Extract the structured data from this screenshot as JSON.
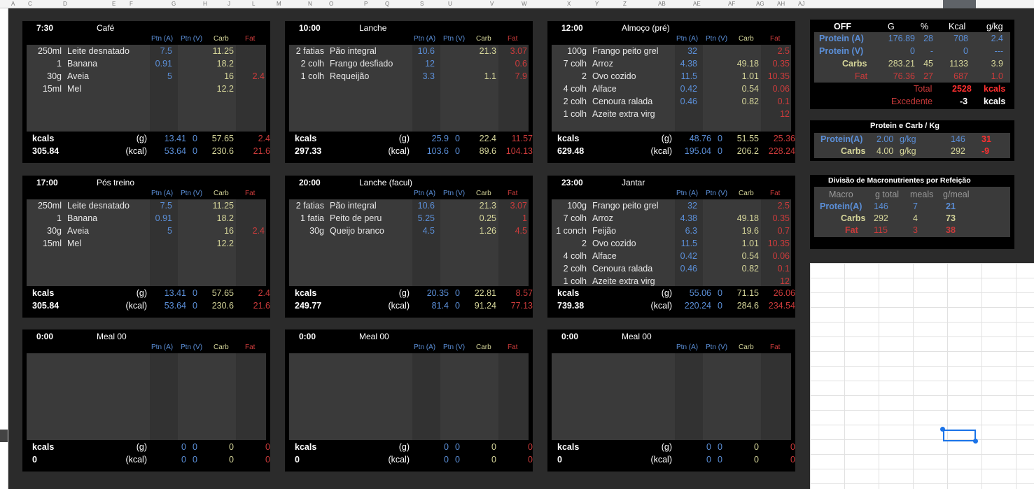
{
  "columns": [
    "A",
    "",
    "C",
    "",
    "D",
    "",
    "E",
    "",
    "F",
    "",
    "G",
    "",
    "H",
    "",
    "J",
    "",
    "L",
    "",
    "M",
    "",
    "N",
    "",
    "O",
    "",
    "P",
    "",
    "Q",
    "",
    "S",
    "",
    "U",
    "",
    "V",
    "",
    "W",
    "",
    "X",
    "",
    "Y",
    "",
    "Z",
    "",
    "AB",
    "",
    "AE",
    "",
    "AF",
    "",
    "AG",
    "",
    "AH",
    "",
    "AJ"
  ],
  "header_labels": {
    "ptn_a": "Ptn (A)",
    "ptn_v": "Ptn (V)",
    "carb": "Carb",
    "fat": "Fat"
  },
  "footer_labels": {
    "kcals": "kcals",
    "g": "(g)",
    "kcal": "(kcal)"
  },
  "meals": [
    {
      "time": "7:30",
      "name": "Café",
      "kcals": "305.84",
      "rows": [
        {
          "qty": "250ml",
          "food": "Leite desnatado",
          "pa": "7.5",
          "pv": "",
          "carb": "11.25",
          "fat": ""
        },
        {
          "qty": "1",
          "food": "Banana",
          "pa": "0.91",
          "pv": "",
          "carb": "18.2",
          "fat": ""
        },
        {
          "qty": "30g",
          "food": "Aveia",
          "pa": "5",
          "pv": "",
          "carb": "16",
          "fat": "2.4"
        },
        {
          "qty": "15ml",
          "food": "Mel",
          "pa": "",
          "pv": "",
          "carb": "12.2",
          "fat": ""
        }
      ],
      "g": {
        "pa": "13.41",
        "pv": "0",
        "carb": "57.65",
        "fat": "2.4"
      },
      "kcal": {
        "pa": "53.64",
        "pv": "0",
        "carb": "230.6",
        "fat": "21.6"
      }
    },
    {
      "time": "10:00",
      "name": "Lanche",
      "kcals": "297.33",
      "rows": [
        {
          "qty": "2 fatias",
          "food": "Pão integral",
          "pa": "10.6",
          "pv": "",
          "carb": "21.3",
          "fat": "3.07"
        },
        {
          "qty": "2 colh",
          "food": "Frango desfiado",
          "pa": "12",
          "pv": "",
          "carb": "",
          "fat": "0.6"
        },
        {
          "qty": "1 colh",
          "food": "Requeijão",
          "pa": "3.3",
          "pv": "",
          "carb": "1.1",
          "fat": "7.9"
        }
      ],
      "g": {
        "pa": "25.9",
        "pv": "0",
        "carb": "22.4",
        "fat": "11.57"
      },
      "kcal": {
        "pa": "103.6",
        "pv": "0",
        "carb": "89.6",
        "fat": "104.13"
      }
    },
    {
      "time": "12:00",
      "name": "Almoço (pré)",
      "kcals": "629.48",
      "rows": [
        {
          "qty": "100g",
          "food": "Frango peito grel",
          "pa": "32",
          "pv": "",
          "carb": "",
          "fat": "2.5"
        },
        {
          "qty": "7 colh",
          "food": "Arroz",
          "pa": "4.38",
          "pv": "",
          "carb": "49.18",
          "fat": "0.35"
        },
        {
          "qty": "2",
          "food": "Ovo cozido",
          "pa": "11.5",
          "pv": "",
          "carb": "1.01",
          "fat": "10.35"
        },
        {
          "qty": "4 colh",
          "food": "Alface",
          "pa": "0.42",
          "pv": "",
          "carb": "0.54",
          "fat": "0.06"
        },
        {
          "qty": "2 colh",
          "food": "Cenoura ralada",
          "pa": "0.46",
          "pv": "",
          "carb": "0.82",
          "fat": "0.1"
        },
        {
          "qty": "1 colh",
          "food": "Azeite extra virg",
          "pa": "",
          "pv": "",
          "carb": "",
          "fat": "12"
        }
      ],
      "g": {
        "pa": "48.76",
        "pv": "0",
        "carb": "51.55",
        "fat": "25.36"
      },
      "kcal": {
        "pa": "195.04",
        "pv": "0",
        "carb": "206.2",
        "fat": "228.24"
      }
    },
    {
      "time": "17:00",
      "name": "Pós treino",
      "kcals": "305.84",
      "rows": [
        {
          "qty": "250ml",
          "food": "Leite desnatado",
          "pa": "7.5",
          "pv": "",
          "carb": "11.25",
          "fat": ""
        },
        {
          "qty": "1",
          "food": "Banana",
          "pa": "0.91",
          "pv": "",
          "carb": "18.2",
          "fat": ""
        },
        {
          "qty": "30g",
          "food": "Aveia",
          "pa": "5",
          "pv": "",
          "carb": "16",
          "fat": "2.4"
        },
        {
          "qty": "15ml",
          "food": "Mel",
          "pa": "",
          "pv": "",
          "carb": "12.2",
          "fat": ""
        }
      ],
      "g": {
        "pa": "13.41",
        "pv": "0",
        "carb": "57.65",
        "fat": "2.4"
      },
      "kcal": {
        "pa": "53.64",
        "pv": "0",
        "carb": "230.6",
        "fat": "21.6"
      }
    },
    {
      "time": "20:00",
      "name": "Lanche (facul)",
      "kcals": "249.77",
      "rows": [
        {
          "qty": "2 fatias",
          "food": "Pão integral",
          "pa": "10.6",
          "pv": "",
          "carb": "21.3",
          "fat": "3.07"
        },
        {
          "qty": "1 fatia",
          "food": "Peito de peru",
          "pa": "5.25",
          "pv": "",
          "carb": "0.25",
          "fat": "1"
        },
        {
          "qty": "30g",
          "food": "Queijo branco",
          "pa": "4.5",
          "pv": "",
          "carb": "1.26",
          "fat": "4.5"
        }
      ],
      "g": {
        "pa": "20.35",
        "pv": "0",
        "carb": "22.81",
        "fat": "8.57"
      },
      "kcal": {
        "pa": "81.4",
        "pv": "0",
        "carb": "91.24",
        "fat": "77.13"
      }
    },
    {
      "time": "23:00",
      "name": "Jantar",
      "kcals": "739.38",
      "rows": [
        {
          "qty": "100g",
          "food": "Frango peito grel",
          "pa": "32",
          "pv": "",
          "carb": "",
          "fat": "2.5"
        },
        {
          "qty": "7 colh",
          "food": "Arroz",
          "pa": "4.38",
          "pv": "",
          "carb": "49.18",
          "fat": "0.35"
        },
        {
          "qty": "1 conch",
          "food": "Feijão",
          "pa": "6.3",
          "pv": "",
          "carb": "19.6",
          "fat": "0.7"
        },
        {
          "qty": "2",
          "food": "Ovo cozido",
          "pa": "11.5",
          "pv": "",
          "carb": "1.01",
          "fat": "10.35"
        },
        {
          "qty": "4 colh",
          "food": "Alface",
          "pa": "0.42",
          "pv": "",
          "carb": "0.54",
          "fat": "0.06"
        },
        {
          "qty": "2 colh",
          "food": "Cenoura ralada",
          "pa": "0.46",
          "pv": "",
          "carb": "0.82",
          "fat": "0.1"
        },
        {
          "qty": "1 colh",
          "food": "Azeite extra virg",
          "pa": "",
          "pv": "",
          "carb": "",
          "fat": "12"
        }
      ],
      "g": {
        "pa": "55.06",
        "pv": "0",
        "carb": "71.15",
        "fat": "26.06"
      },
      "kcal": {
        "pa": "220.24",
        "pv": "0",
        "carb": "284.6",
        "fat": "234.54"
      }
    },
    {
      "time": "0:00",
      "name": "Meal 00",
      "kcals": "0",
      "rows": [],
      "g": {
        "pa": "0",
        "pv": "0",
        "carb": "0",
        "fat": "0"
      },
      "kcal": {
        "pa": "0",
        "pv": "0",
        "carb": "0",
        "fat": "0"
      }
    },
    {
      "time": "0:00",
      "name": "Meal 00",
      "kcals": "0",
      "rows": [],
      "g": {
        "pa": "0",
        "pv": "0",
        "carb": "0",
        "fat": "0"
      },
      "kcal": {
        "pa": "0",
        "pv": "0",
        "carb": "0",
        "fat": "0"
      }
    },
    {
      "time": "0:00",
      "name": "Meal 00",
      "kcals": "0",
      "rows": [],
      "g": {
        "pa": "0",
        "pv": "0",
        "carb": "0",
        "fat": "0"
      },
      "kcal": {
        "pa": "0",
        "pv": "0",
        "carb": "0",
        "fat": "0"
      }
    }
  ],
  "summary": {
    "headers": {
      "off": "OFF",
      "g": "G",
      "pct": "%",
      "kcal": "Kcal",
      "gkg": "g/kg"
    },
    "rows": [
      {
        "label": "Protein (A)",
        "g": "176.89",
        "pct": "28",
        "kcal": "708",
        "gkg": "2.4"
      },
      {
        "label": "Protein (V)",
        "g": "0",
        "pct": "-",
        "kcal": "0",
        "gkg": "---"
      },
      {
        "label": "Carbs",
        "g": "283.21",
        "pct": "45",
        "kcal": "1133",
        "gkg": "3.9"
      },
      {
        "label": "Fat",
        "g": "76.36",
        "pct": "27",
        "kcal": "687",
        "gkg": "1.0"
      }
    ],
    "total_label": "Total",
    "total_value": "2528",
    "total_unit": "kcals",
    "excedente_label": "Excedente",
    "excedente_value": "-3",
    "excedente_unit": "kcals"
  },
  "pck": {
    "title": "Protein e Carb / Kg",
    "rows": [
      {
        "label": "Protein(A)",
        "value": "2.00",
        "unit": "g/kg",
        "g": "146",
        "diff": "31"
      },
      {
        "label": "Carbs",
        "value": "4.00",
        "unit": "g/kg",
        "g": "292",
        "diff": "-9"
      }
    ]
  },
  "division": {
    "title": "Divisão de Macronutrientes por Refeição",
    "headers": {
      "macro": "Macro",
      "gtotal": "g total",
      "meals": "meals",
      "gmeal": "g/meal"
    },
    "rows": [
      {
        "label": "Protein(A)",
        "gtotal": "146",
        "meals": "7",
        "gmeal": "21"
      },
      {
        "label": "Carbs",
        "gtotal": "292",
        "meals": "4",
        "gmeal": "73"
      },
      {
        "label": "Fat",
        "gtotal": "115",
        "meals": "3",
        "gmeal": "38"
      }
    ]
  },
  "colors": {
    "protein": "#5b8fd8",
    "carb": "#d6d69a",
    "fat": "#cc3b3b",
    "panel": "#000000",
    "cell": "#3a3a3a"
  }
}
